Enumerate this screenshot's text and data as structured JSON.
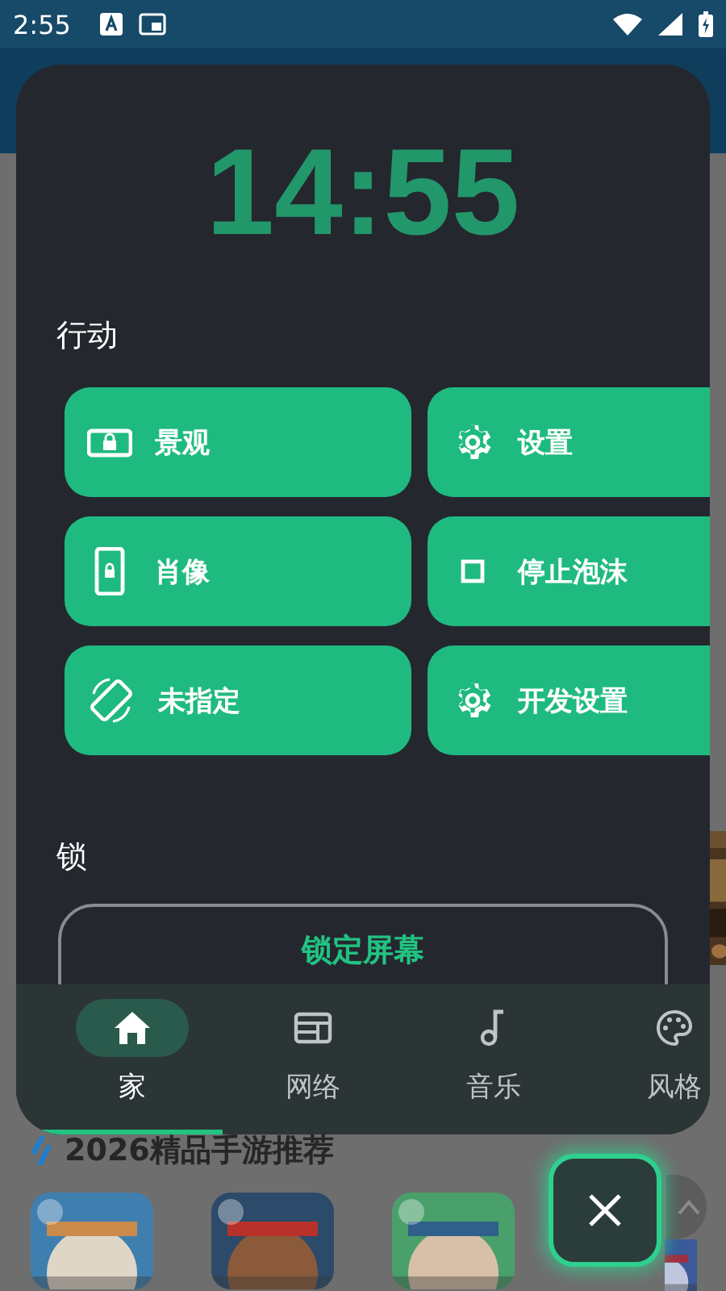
{
  "status_bar": {
    "time": "2:55"
  },
  "background_page": {
    "section_title": "2026精品手游推荐"
  },
  "panel": {
    "clock": "14:55",
    "actions_title": "行动",
    "actions": [
      {
        "label": "景观",
        "kind": "landscape"
      },
      {
        "label": "设置",
        "kind": "gear"
      },
      {
        "label": "肖像",
        "kind": "portrait"
      },
      {
        "label": "停止泡沫",
        "kind": "square"
      },
      {
        "label": "未指定",
        "kind": "rotate"
      },
      {
        "label": "开发设置",
        "kind": "gear"
      }
    ],
    "lock_title": "锁",
    "lock_button": "锁定屏幕"
  },
  "nav": [
    {
      "label": "家",
      "kind": "home",
      "selected": true
    },
    {
      "label": "网络",
      "kind": "web",
      "selected": false
    },
    {
      "label": "音乐",
      "kind": "music",
      "selected": false
    },
    {
      "label": "风格",
      "kind": "palette",
      "selected": false
    }
  ]
}
